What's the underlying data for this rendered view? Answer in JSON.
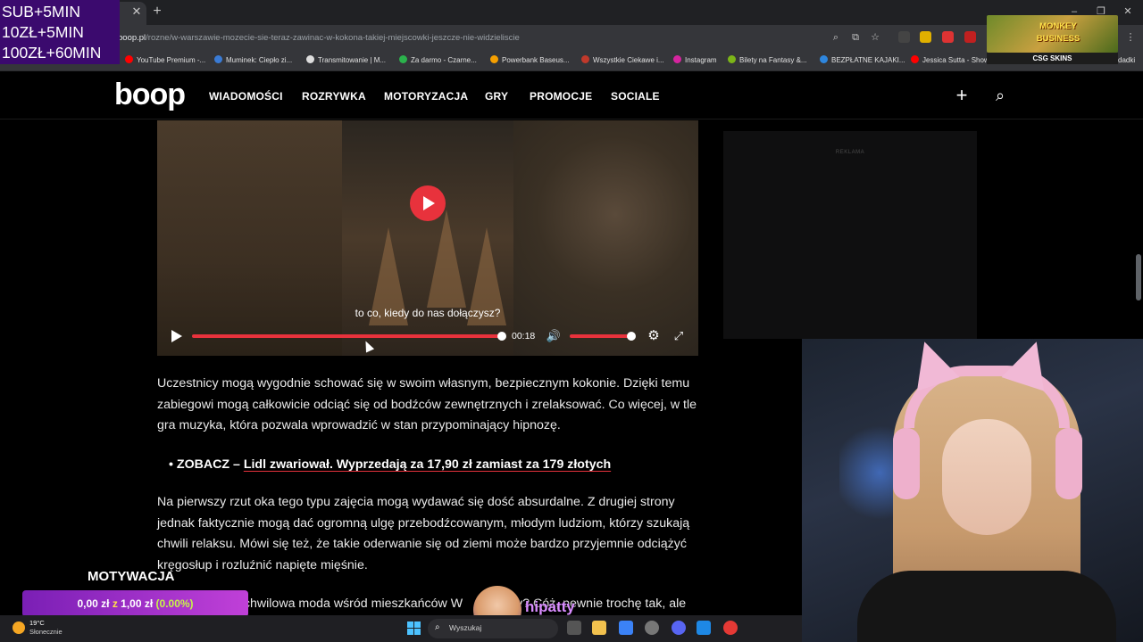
{
  "browser": {
    "url_domain": "boop.pl",
    "url_path": "/rozne/w-warszawie-mozecie-sie-teraz-zawinac-w-kokona-takiej-miejscowki-jeszcze-nie-widzieliscie",
    "tab_close": "✕",
    "new_tab": "+",
    "bookmarks": [
      "YouTube Premium -...",
      "Muminek: Ciepło zi...",
      "Transmitowanie | M...",
      "Za darmo - Czarne...",
      "Powerbank Baseus...",
      "Wszystkie Ciekawe i...",
      "Instagram",
      "Bilety na Fantasy &...",
      "BEZPŁATNE KAJAKI...",
      "Jessica Sutta - Show",
      "dadki"
    ]
  },
  "site": {
    "logo": "boop",
    "nav": [
      "WIADOMOŚCI",
      "ROZRYWKA",
      "MOTORYZACJA",
      "GRY",
      "PROMOCJE",
      "SOCIALE"
    ]
  },
  "video": {
    "subtitle": "to co, kiedy do nas dołączysz?",
    "time": "00:18",
    "progress": 1.0,
    "volume": 1.0
  },
  "article": {
    "p1": "Uczestnicy mogą wygodnie schować się w swoim własnym, bezpiecznym kokonie. Dzięki temu zabiegowi mogą całkowicie odciąć się od bodźców zewnętrznych i zrelaksować. Co więcej, w tle gra muzyka, która pozwala wprowadzić w stan przypominający hipnozę.",
    "bullet_prefix": "ZOBACZ – ",
    "bullet_link": "Lidl zwariował. Wyprzedają za 17,90 zł zamiast za 179 złotych",
    "p2": "Na pierwszy rzut oka tego typu zajęcia mogą wydawać się dość absurdalne. Z drugiej strony jednak faktycznie mogą dać ogromną ulgę przebodźcowanym, młodym ludziom, którzy szukają chwili relaksu. Mówi się też, że takie oderwanie się od ziemi może bardzo przyjemnie odciążyć kręgosłup i rozluźnić napięte mięśnie.",
    "p3_visible": "kolejna chwilowa moda wśród mieszkańców W",
    "p3_end": "y? Cóż, pewnie trochę tak, ale"
  },
  "ad": {
    "label": "REKLAMA"
  },
  "stream": {
    "sub_lines": [
      "SUB+5MIN",
      "10ZŁ+5MIN",
      "100ZŁ+60MIN"
    ],
    "game_ad_text": "MONKEY BUSINESS",
    "csg_label": "CSG SKINS",
    "motywacja": "MOTYWACJA",
    "goal_current": "0,00 zł",
    "goal_of": "z",
    "goal_target": "1,00 zł",
    "goal_percent": "(0.00%)",
    "streamer_name": "hipatty"
  },
  "taskbar": {
    "temp": "19°C",
    "weather": "Słonecznie",
    "search": "Wyszukaj"
  },
  "colors": {
    "accent": "#e8323c",
    "goal_bar": "#a030c8",
    "browser_chrome": "#35363a"
  }
}
